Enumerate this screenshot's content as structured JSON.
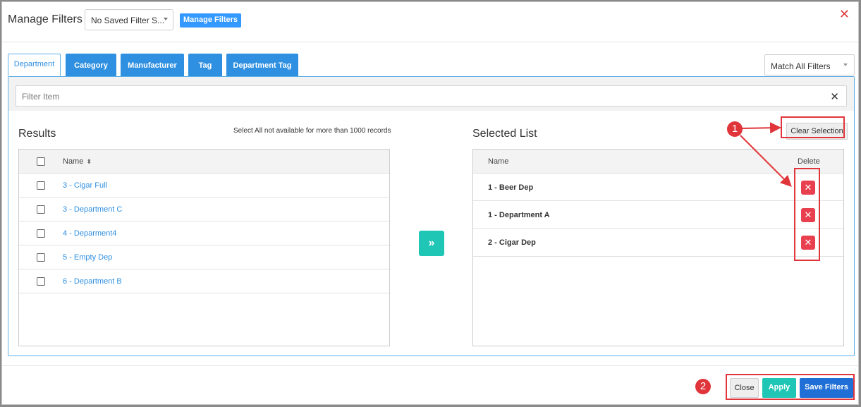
{
  "header": {
    "title": "Manage Filters",
    "saved_filter_value": "No Saved Filter S...",
    "manage_button": "Manage Filters",
    "close_glyph": "✕"
  },
  "tabs": [
    {
      "label": "Department",
      "active": true
    },
    {
      "label": "Category",
      "active": false
    },
    {
      "label": "Manufacturer",
      "active": false
    },
    {
      "label": "Tag",
      "active": false
    },
    {
      "label": "Department Tag",
      "active": false
    }
  ],
  "match_select": {
    "value": "Match All Filters"
  },
  "filter": {
    "placeholder": "Filter Item",
    "clear_glyph": "✕"
  },
  "results": {
    "title": "Results",
    "note": "Select All not available for more than 1000 records",
    "column_name": "Name",
    "sort_glyph": "⬍",
    "rows": [
      "3 - Cigar Full",
      "3 - Department C",
      "4 - Deparment4",
      "5 - Empty Dep",
      "6 - Department B"
    ]
  },
  "move_button": {
    "glyph": "»"
  },
  "selected": {
    "title": "Selected List",
    "clear_button": "Clear Selection",
    "column_name": "Name",
    "column_delete": "Delete",
    "delete_glyph": "✕",
    "rows": [
      "1 - Beer Dep",
      "1 - Department A",
      "2 - Cigar Dep"
    ]
  },
  "footer": {
    "close": "Close",
    "apply": "Apply",
    "save": "Save Filters"
  },
  "annotations": {
    "badge_1": "1",
    "badge_2": "2"
  },
  "colors": {
    "primary": "#2f8fe0",
    "teal": "#1fc6b6",
    "danger": "#e8404f",
    "annotation": "#e0353a"
  }
}
